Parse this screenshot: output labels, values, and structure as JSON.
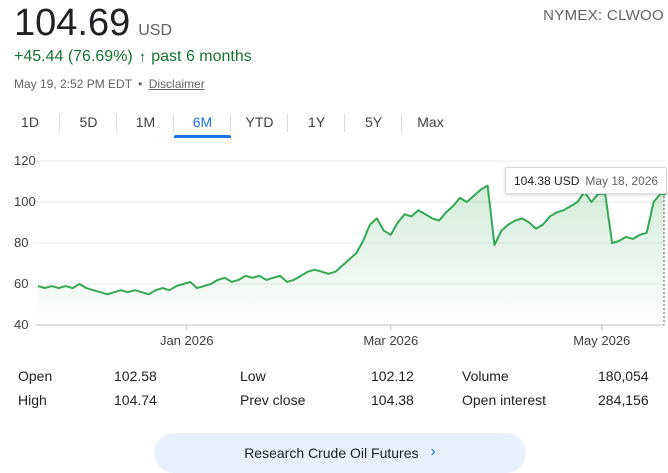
{
  "quote": {
    "price": "104.69",
    "currency": "USD",
    "ticker": "NYMEX: CLWOO",
    "change": "+45.44 (76.69%)",
    "change_arrow": "↑",
    "change_period": "past 6 months",
    "timestamp": "May 19, 2:52 PM EDT",
    "separator": "•",
    "disclaimer": "Disclaimer",
    "colors": {
      "up": "#137333",
      "accent": "#1a73e8"
    }
  },
  "ranges": [
    {
      "label": "1D",
      "active": false
    },
    {
      "label": "5D",
      "active": false
    },
    {
      "label": "1M",
      "active": false
    },
    {
      "label": "6M",
      "active": true
    },
    {
      "label": "YTD",
      "active": false
    },
    {
      "label": "1Y",
      "active": false
    },
    {
      "label": "5Y",
      "active": false
    },
    {
      "label": "Max",
      "active": false
    }
  ],
  "chart_data": {
    "type": "area",
    "line_color": "#34a853",
    "y_ticks": [
      "120",
      "100",
      "80",
      "60",
      "40"
    ],
    "ylim": [
      40,
      120
    ],
    "x_ticks": [
      {
        "label": "Jan 2026",
        "date": "2026-01-01"
      },
      {
        "label": "Mar 2026",
        "date": "2026-03-01"
      },
      {
        "label": "May 2026",
        "date": "2026-05-01"
      }
    ],
    "grid": true,
    "series": [
      {
        "dates": [
          "2025-11-19",
          "2025-11-21",
          "2025-11-23",
          "2025-11-25",
          "2025-11-27",
          "2025-11-29",
          "2025-12-01",
          "2025-12-03",
          "2025-12-05",
          "2025-12-07",
          "2025-12-09",
          "2025-12-11",
          "2025-12-13",
          "2025-12-15",
          "2025-12-17",
          "2025-12-19",
          "2025-12-21",
          "2025-12-23",
          "2025-12-25",
          "2025-12-27",
          "2025-12-29",
          "2025-12-31",
          "2026-01-02",
          "2026-01-04",
          "2026-01-06",
          "2026-01-08",
          "2026-01-10",
          "2026-01-12",
          "2026-01-14",
          "2026-01-16",
          "2026-01-18",
          "2026-01-20",
          "2026-01-22",
          "2026-01-24",
          "2026-01-26",
          "2026-01-28",
          "2026-01-30",
          "2026-02-01",
          "2026-02-03",
          "2026-02-05",
          "2026-02-07",
          "2026-02-09",
          "2026-02-11",
          "2026-02-13",
          "2026-02-15",
          "2026-02-17",
          "2026-02-19",
          "2026-02-21",
          "2026-02-23",
          "2026-02-25",
          "2026-02-27",
          "2026-03-01",
          "2026-03-03",
          "2026-03-05",
          "2026-03-07",
          "2026-03-09",
          "2026-03-11",
          "2026-03-13",
          "2026-03-15",
          "2026-03-17",
          "2026-03-19",
          "2026-03-21",
          "2026-03-23",
          "2026-03-25",
          "2026-03-27",
          "2026-03-29",
          "2026-03-31",
          "2026-04-02",
          "2026-04-04",
          "2026-04-06",
          "2026-04-08",
          "2026-04-10",
          "2026-04-12",
          "2026-04-14",
          "2026-04-16",
          "2026-04-18",
          "2026-04-20",
          "2026-04-22",
          "2026-04-24",
          "2026-04-26",
          "2026-04-28",
          "2026-04-30",
          "2026-05-02",
          "2026-05-04",
          "2026-05-06",
          "2026-05-08",
          "2026-05-10",
          "2026-05-12",
          "2026-05-14",
          "2026-05-16",
          "2026-05-18",
          "2026-05-19"
        ],
        "values": [
          59,
          58,
          59,
          58,
          59,
          58,
          60,
          58,
          57,
          56,
          55,
          56,
          57,
          56,
          57,
          56,
          55,
          57,
          58,
          57,
          59,
          60,
          61,
          58,
          59,
          60,
          62,
          63,
          61,
          62,
          64,
          63,
          64,
          62,
          63,
          64,
          61,
          62,
          64,
          66,
          67,
          66,
          65,
          66,
          69,
          72,
          75,
          81,
          89,
          92,
          86,
          84,
          90,
          94,
          93,
          96,
          94,
          92,
          91,
          95,
          98,
          102,
          100,
          103,
          106,
          108,
          79,
          86,
          89,
          91,
          92,
          90,
          87,
          89,
          93,
          95,
          96,
          98,
          100,
          105,
          100,
          104,
          104,
          80,
          81,
          83,
          82,
          84,
          85,
          100,
          104,
          104.69
        ]
      }
    ],
    "hover": {
      "value": "104.38 USD",
      "date": "May 18, 2026"
    }
  },
  "stats": {
    "col1": [
      {
        "label": "Open",
        "value": "102.58"
      },
      {
        "label": "High",
        "value": "104.74"
      }
    ],
    "col2": [
      {
        "label": "Low",
        "value": "102.12"
      },
      {
        "label": "Prev close",
        "value": "104.38"
      }
    ],
    "col3": [
      {
        "label": "Volume",
        "value": "180,054"
      },
      {
        "label": "Open interest",
        "value": "284,156"
      }
    ]
  },
  "research_button": {
    "label": "Research Crude Oil Futures",
    "chevron": "›"
  }
}
